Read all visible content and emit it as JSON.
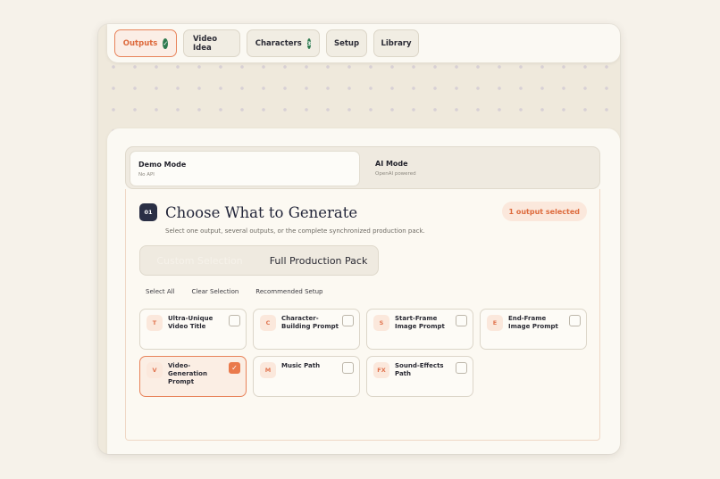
{
  "tabs": [
    {
      "label": "Outputs",
      "active": true,
      "badge": "✓"
    },
    {
      "label": "Video Idea"
    },
    {
      "label": "Characters",
      "badge": "3"
    },
    {
      "label": "Setup"
    },
    {
      "label": "Library"
    }
  ],
  "modes": {
    "demo": {
      "title": "Demo Mode",
      "subtitle": "No API"
    },
    "ai": {
      "title": "AI Mode",
      "subtitle": "OpenAI powered"
    }
  },
  "section": {
    "step": "01",
    "title": "Choose What to Generate",
    "subtitle": "Select one output, several outputs, or the complete synchronized production pack.",
    "selected_count": "1 output selected"
  },
  "segmented": {
    "custom": "Custom Selection",
    "full": "Full Production Pack"
  },
  "actions": {
    "select_all": "Select All",
    "clear": "Clear Selection",
    "recommended": "Recommended Setup"
  },
  "outputs": [
    {
      "icon": "T",
      "label": "Ultra-Unique Video Title",
      "checked": false
    },
    {
      "icon": "C",
      "label": "Character-Building Prompt",
      "checked": false
    },
    {
      "icon": "S",
      "label": "Start-Frame Image Prompt",
      "checked": false
    },
    {
      "icon": "E",
      "label": "End-Frame Image Prompt",
      "checked": false
    },
    {
      "icon": "V",
      "label": "Video-Generation Prompt",
      "checked": true
    },
    {
      "icon": "M",
      "label": "Music Path",
      "checked": false
    },
    {
      "icon": "FX",
      "label": "Sound-Effects Path",
      "checked": false
    }
  ],
  "colors": {
    "accent": "#e8835a",
    "success": "#2f7a4f",
    "dark": "#2a2f45"
  }
}
